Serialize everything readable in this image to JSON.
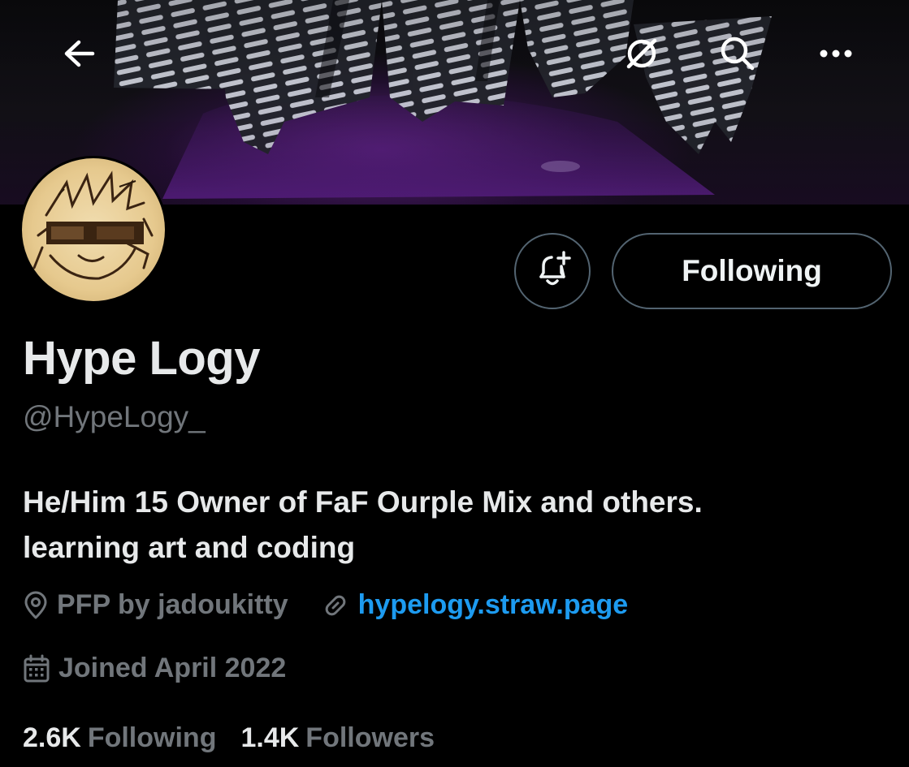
{
  "header": {
    "back_icon": "arrow-left-icon",
    "grok_icon": "grok-slash-icon",
    "search_icon": "search-icon",
    "more_icon": "more-horizontal-icon"
  },
  "profile": {
    "display_name": "Hype Logy",
    "handle": "@HypeLogy_",
    "bio_lines": [
      "He/Him 15 Owner of FaF Ourple Mix and others.",
      "learning art and coding"
    ],
    "location": "PFP by jadoukitty",
    "website": "hypelogy.straw.page",
    "joined": "Joined April 2022"
  },
  "actions": {
    "notify_icon": "bell-plus-icon",
    "follow_label": "Following"
  },
  "stats": {
    "following_count": "2.6K",
    "following_label": "Following",
    "followers_count": "1.4K",
    "followers_label": "Followers"
  },
  "colors": {
    "background": "#000000",
    "text_primary": "#e7e9ea",
    "text_secondary": "#71767b",
    "link": "#1d9bf0",
    "border": "#536471"
  }
}
